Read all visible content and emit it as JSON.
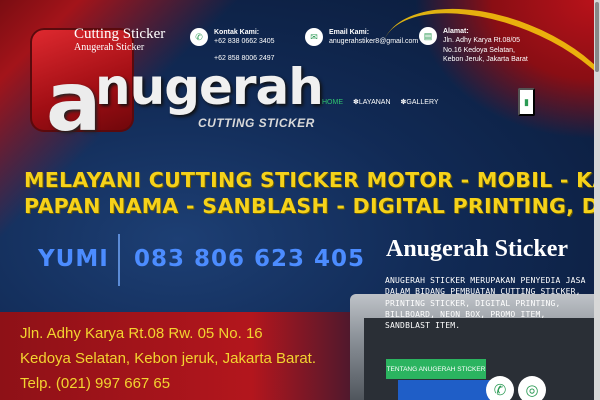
{
  "site": {
    "title": "Cutting Sticker",
    "tagline": "Anugerah Sticker"
  },
  "logo": {
    "letter": "a",
    "word": "nugerah",
    "sub": "CUTTING STICKER"
  },
  "contacts": [
    {
      "label": "Kontak Kami:",
      "lines": [
        "+62 838 0662 3405",
        "+62 858 8006 2497"
      ],
      "icon": "phone-icon"
    },
    {
      "label": "Email Kami:",
      "lines": [
        "anugerahstiker8@gmail.com"
      ],
      "icon": "mail-icon"
    },
    {
      "label": "Alamat:",
      "lines": [
        "Jln. Adhy Karya Rt.08/05",
        "No.16 Kedoya Selatan,",
        "Kebon Jeruk, Jakarta Barat"
      ],
      "icon": "map-icon"
    }
  ],
  "nav": {
    "items": [
      "HOME",
      "LAYANAN",
      "GALLERY"
    ],
    "active": "HOME",
    "menu_icon": "menu-icon"
  },
  "banner": {
    "line1": "MELAYANI CUTTING STICKER MOTOR - MOBIL - KACA - NEONBOX",
    "line2": "PAPAN NAMA - SANBLASH - DIGITAL PRINTING, DLL",
    "name": "YUMI",
    "phone": "083 806 623 405",
    "address": [
      "Jln. Adhy Karya Rt.08 Rw. 05 No. 16",
      "Kedoya Selatan, Kebon jeruk, Jakarta Barat.",
      "Telp. (021) 997 667 65"
    ]
  },
  "hero": {
    "title": "Anugerah Sticker",
    "description": "ANUGERAH STICKER MERUPAKAN PENYEDIA JASA DALAM BIDANG PEMBUATAN CUTTING STICKER, PRINTING STICKER, DIGITAL PRINTING, BILLBOARD, NEON BOX, PROMO ITEM, SANDBLAST ITEM.",
    "cta": "TENTANG ANUGERAH STICKER"
  },
  "colors": {
    "accent_green": "#2bb460",
    "banner_yellow": "#f6d21a",
    "phone_blue": "#4c8cff",
    "brand_red": "#b3161d"
  }
}
